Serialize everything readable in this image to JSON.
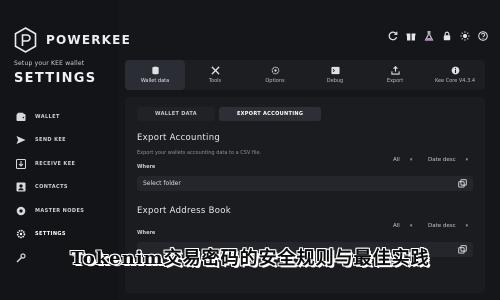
{
  "sidebar": {
    "brand": "POWERKEE",
    "subtitle": "Setup your KEE wallet",
    "section_title": "SETTINGS",
    "items": [
      {
        "label": "WALLET",
        "icon": "wallet-icon"
      },
      {
        "label": "SEND KEE",
        "icon": "send-icon"
      },
      {
        "label": "RECEIVE KEE",
        "icon": "receive-icon"
      },
      {
        "label": "CONTACTS",
        "icon": "contacts-icon"
      },
      {
        "label": "MASTER NODES",
        "icon": "master-nodes-icon"
      },
      {
        "label": "SETTINGS",
        "icon": "gear-icon",
        "active": true
      },
      {
        "label": "",
        "icon": "tools-icon"
      }
    ]
  },
  "tabs": [
    {
      "label": "Wallet data",
      "icon": "database-icon",
      "active": true
    },
    {
      "label": "Tools",
      "icon": "tools-icon"
    },
    {
      "label": "Options",
      "icon": "options-icon"
    },
    {
      "label": "Debug",
      "icon": "debug-icon"
    },
    {
      "label": "Export",
      "icon": "export-icon"
    },
    {
      "label": "Kee Core V4.3.4",
      "icon": "info-icon"
    }
  ],
  "subtabs": [
    {
      "label": "WALLET DATA"
    },
    {
      "label": "EXPORT ACCOUNTING",
      "active": true
    }
  ],
  "export_accounting": {
    "title": "Export Accounting",
    "description": "Export your wallets accounting data to a CSV file.",
    "where_label": "Where",
    "filter_all": "All",
    "sort": "Date desc",
    "folder_placeholder": "Select folder"
  },
  "export_address_book": {
    "title": "Export Address Book",
    "where_label": "Where",
    "filter_all": "All",
    "sort": "Date desc"
  },
  "caption": "Tokenim交易密码的安全规则与最佳实践",
  "colors": {
    "accent": "#2c2f35",
    "background": "#151619"
  }
}
